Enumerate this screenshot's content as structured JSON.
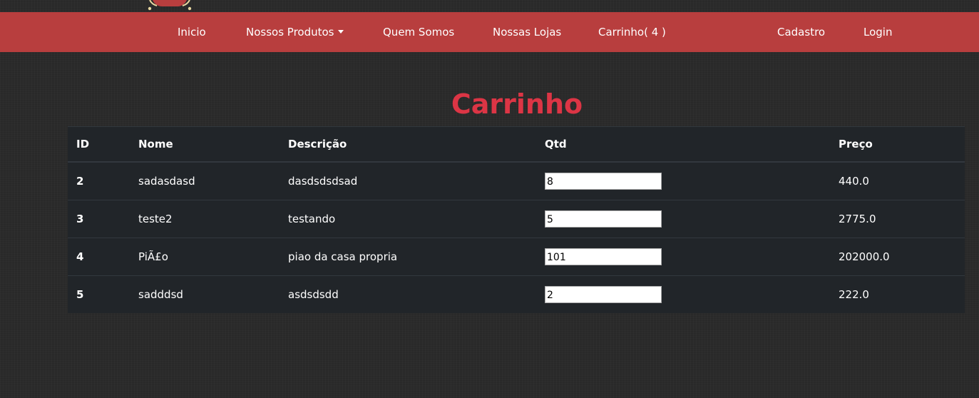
{
  "nav": {
    "items": [
      {
        "label": "Inicio"
      },
      {
        "label": "Nossos Produtos"
      },
      {
        "label": "Quem Somos"
      },
      {
        "label": "Nossas Lojas"
      },
      {
        "label": "Carrinho( 4 )"
      },
      {
        "label": "Cadastro"
      },
      {
        "label": "Login"
      }
    ]
  },
  "main": {
    "title": "Carrinho"
  },
  "cart_table": {
    "headers": [
      "ID",
      "Nome",
      "Descrição",
      "Qtd",
      "Preço"
    ],
    "rows": [
      {
        "id": "2",
        "name": "sadasdasd",
        "description": "dasdsdsdsad",
        "qty": "8",
        "price": "440.0"
      },
      {
        "id": "3",
        "name": "teste2",
        "description": "testando",
        "qty": "5",
        "price": "2775.0"
      },
      {
        "id": "4",
        "name": "PiÃ£o",
        "description": "piao da casa propria",
        "qty": "101",
        "price": "202000.0"
      },
      {
        "id": "5",
        "name": "sadddsd",
        "description": "asdsdsdd",
        "qty": "2",
        "price": "222.0"
      }
    ]
  },
  "colors": {
    "navbar": "#b83e3e",
    "title": "#dc3545",
    "table_bg": "#212529",
    "page_bg": "#2b2b2b"
  }
}
